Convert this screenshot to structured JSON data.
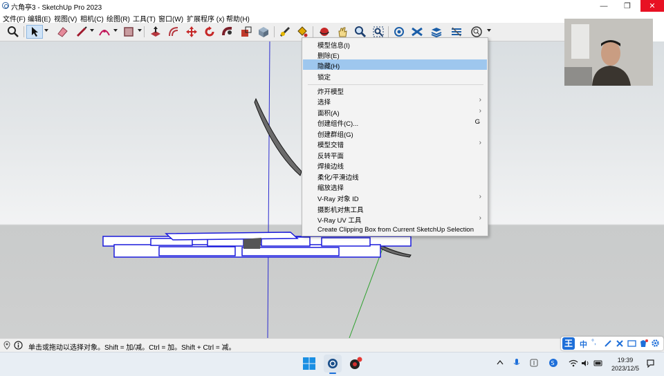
{
  "window": {
    "title": "六角亭3 - SketchUp Pro 2023",
    "minimize_glyph": "—",
    "maximize_glyph": "❐",
    "close_glyph": "✕"
  },
  "menu": [
    "文件(F)",
    "编辑(E)",
    "视图(V)",
    "相机(C)",
    "绘图(R)",
    "工具(T)",
    "窗口(W)",
    "扩展程序 (x)",
    "帮助(H)"
  ],
  "toolbar": {
    "tools": [
      "zoom-extents-icon",
      "select-arrow-icon",
      "eraser-icon",
      "pencil-line-icon",
      "arc-icon",
      "rectangle-icon",
      "push-pull-icon",
      "offset-icon",
      "move-icon",
      "rotate-icon",
      "follow-me-icon",
      "paint-bucket-icon",
      "component-icon",
      "tape-measure-icon",
      "text-label-icon",
      "walk-icon",
      "look-around-icon",
      "zoom-icon",
      "zoom-window-icon",
      "section-plane-icon",
      "layers-icon",
      "styles-icon",
      "shadows-icon",
      "search-icon"
    ]
  },
  "context_menu": {
    "items": [
      {
        "label": "模型信息(I)"
      },
      {
        "label": "删除(E)"
      },
      {
        "label": "隐藏(H)",
        "highlighted": true
      },
      {
        "label": "锁定"
      },
      {
        "separator": true
      },
      {
        "label": "炸开模型"
      },
      {
        "label": "选择",
        "submenu": true
      },
      {
        "label": "面积(A)",
        "submenu": true
      },
      {
        "label": "创建组件(C)...",
        "shortcut": "G"
      },
      {
        "label": "创建群组(G)"
      },
      {
        "label": "模型交错",
        "submenu": true
      },
      {
        "label": "反转平面"
      },
      {
        "label": "焊接边线"
      },
      {
        "label": "柔化/平滑边线"
      },
      {
        "label": "缩放选择"
      },
      {
        "label": "V-Ray 对象 ID",
        "submenu": true
      },
      {
        "label": "摄影机对焦工具"
      },
      {
        "label": "V-Ray UV 工具",
        "submenu": true
      },
      {
        "label": "Create Clipping Box from Current SketchUp Selection"
      }
    ],
    "submenu_glyph": "›"
  },
  "statusbar": {
    "text": "单击或拖动以选择对象。Shift = 加/减。Ctrl = 加。Shift + Ctrl = 减。"
  },
  "ime": {
    "logo": "王",
    "mode": "中",
    "punct": "°,"
  },
  "taskbar": {
    "time": "19:39",
    "date": "2023/12/5"
  },
  "colors": {
    "selection_highlight": "#9ec7ee",
    "selected_edges": "#1a1adc",
    "green_axis": "#2ea02e",
    "blue_axis": "#2a2ad0",
    "close_button": "#e81123"
  }
}
